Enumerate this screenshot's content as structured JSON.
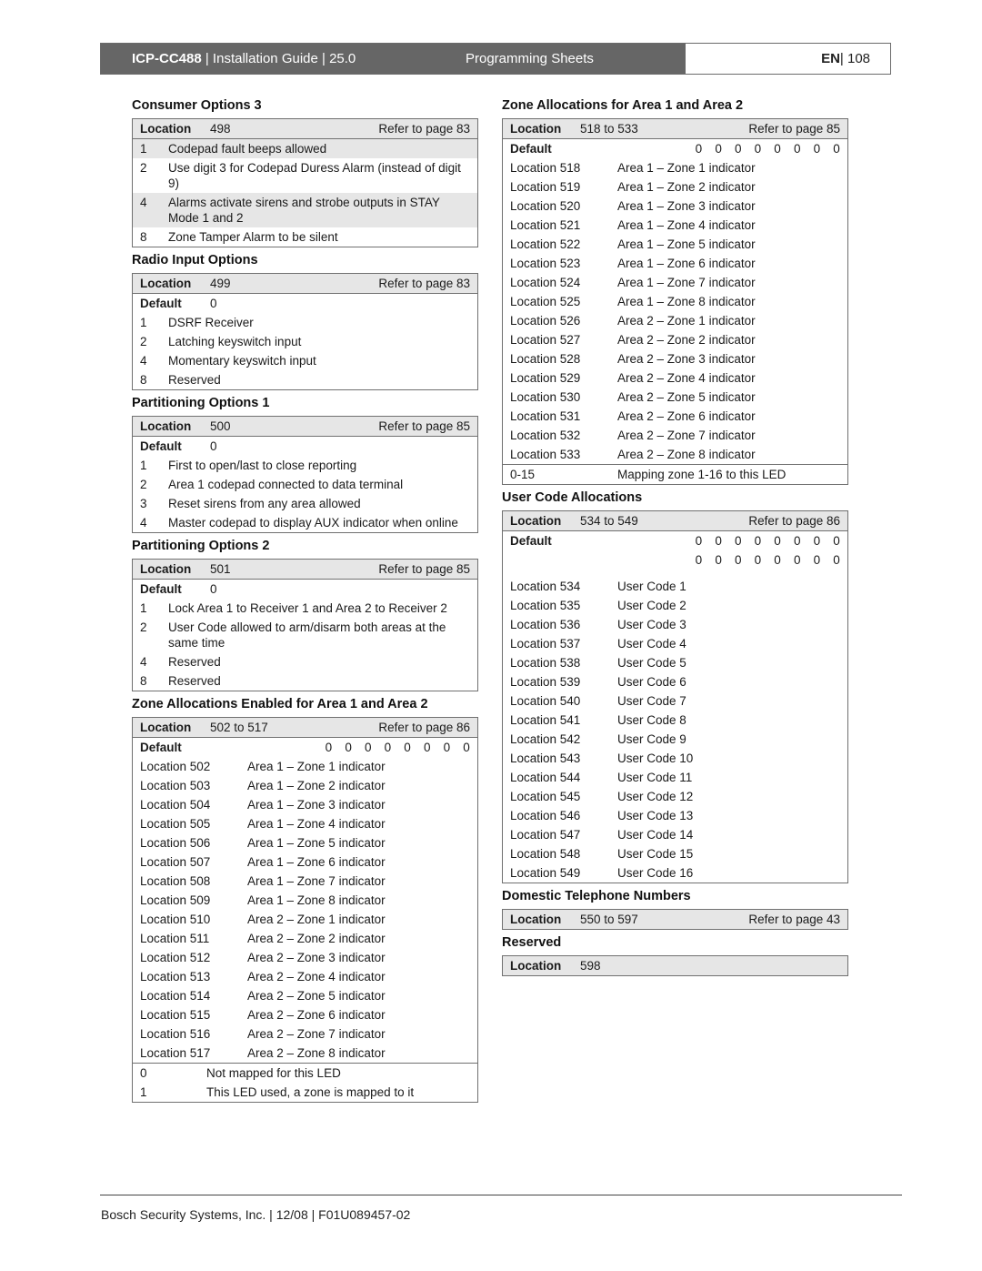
{
  "header": {
    "product": "ICP-CC488",
    "doc_title": " | Installation Guide | 25.0",
    "section": "Programming Sheets",
    "lang": "EN",
    "page": " | 108"
  },
  "left": {
    "consumer3": {
      "title": "Consumer Options 3",
      "loc_label": "Location",
      "loc_value": "498",
      "ref": "Refer to page 83",
      "items": [
        {
          "bit": "1",
          "text": "Codepad fault beeps allowed"
        },
        {
          "bit": "2",
          "text": "Use digit 3 for Codepad Duress Alarm (instead of digit 9)"
        },
        {
          "bit": "4",
          "text": "Alarms activate sirens and strobe outputs in STAY Mode 1 and 2"
        },
        {
          "bit": "8",
          "text": "Zone Tamper Alarm to be silent"
        }
      ]
    },
    "radio": {
      "title": "Radio Input Options",
      "loc_label": "Location",
      "loc_value": "499",
      "ref": "Refer to page 83",
      "def_label": "Default",
      "def_value": "0",
      "items": [
        {
          "bit": "1",
          "text": "DSRF Receiver"
        },
        {
          "bit": "2",
          "text": "Latching keyswitch input"
        },
        {
          "bit": "4",
          "text": "Momentary keyswitch input"
        },
        {
          "bit": "8",
          "text": "Reserved"
        }
      ]
    },
    "part1": {
      "title": "Partitioning Options 1",
      "loc_label": "Location",
      "loc_value": "500",
      "ref": "Refer to page 85",
      "def_label": "Default",
      "def_value": "0",
      "items": [
        {
          "bit": "1",
          "text": "First to open/last to close reporting"
        },
        {
          "bit": "2",
          "text": "Area 1 codepad connected to data terminal"
        },
        {
          "bit": "3",
          "text": "Reset sirens from any area allowed"
        },
        {
          "bit": "4",
          "text": "Master codepad to display AUX indicator when online"
        }
      ]
    },
    "part2": {
      "title": "Partitioning Options 2",
      "loc_label": "Location",
      "loc_value": "501",
      "ref": "Refer to page 85",
      "def_label": "Default",
      "def_value": "0",
      "items": [
        {
          "bit": "1",
          "text": "Lock Area 1 to Receiver 1 and Area 2 to Receiver 2"
        },
        {
          "bit": "2",
          "text": "User Code allowed to arm/disarm both areas at the same time"
        },
        {
          "bit": "4",
          "text": "Reserved"
        },
        {
          "bit": "8",
          "text": "Reserved"
        }
      ]
    },
    "zone_enabled": {
      "title": "Zone Allocations Enabled for Area 1 and Area 2",
      "loc_label": "Location",
      "loc_value": "502 to 517",
      "ref": "Refer to page 86",
      "def_label": "Default",
      "def_value": "0 0 0 0 0 0 0 0",
      "items": [
        {
          "loc": "Location 502",
          "text": "Area 1 – Zone 1 indicator"
        },
        {
          "loc": "Location 503",
          "text": "Area 1 – Zone 2 indicator"
        },
        {
          "loc": "Location 504",
          "text": "Area 1 – Zone 3 indicator"
        },
        {
          "loc": "Location 505",
          "text": "Area 1 – Zone 4 indicator"
        },
        {
          "loc": "Location 506",
          "text": "Area 1 – Zone 5 indicator"
        },
        {
          "loc": "Location 507",
          "text": "Area 1 – Zone 6 indicator"
        },
        {
          "loc": "Location 508",
          "text": "Area 1 – Zone 7 indicator"
        },
        {
          "loc": "Location 509",
          "text": "Area 1 – Zone 8 indicator"
        },
        {
          "loc": "Location 510",
          "text": "Area 2 – Zone 1 indicator"
        },
        {
          "loc": "Location 511",
          "text": "Area 2 – Zone 2 indicator"
        },
        {
          "loc": "Location 512",
          "text": "Area 2 – Zone 3 indicator"
        },
        {
          "loc": "Location 513",
          "text": "Area 2 – Zone 4 indicator"
        },
        {
          "loc": "Location 514",
          "text": "Area 2 – Zone 5 indicator"
        },
        {
          "loc": "Location 515",
          "text": "Area 2 – Zone 6 indicator"
        },
        {
          "loc": "Location 516",
          "text": "Area 2 – Zone 7 indicator"
        },
        {
          "loc": "Location 517",
          "text": "Area 2 – Zone 8 indicator"
        }
      ],
      "legend": [
        {
          "val": "0",
          "text": "Not mapped for this LED"
        },
        {
          "val": "1",
          "text": "This LED used, a zone is mapped to it"
        }
      ]
    }
  },
  "right": {
    "zone_alloc": {
      "title": "Zone Allocations for Area 1 and Area 2",
      "loc_label": "Location",
      "loc_value": "518 to 533",
      "ref": "Refer to page 85",
      "def_label": "Default",
      "def_value": "0 0 0 0 0 0 0 0",
      "items": [
        {
          "loc": "Location 518",
          "text": "Area 1 – Zone 1 indicator"
        },
        {
          "loc": "Location 519",
          "text": "Area 1 – Zone 2 indicator"
        },
        {
          "loc": "Location 520",
          "text": "Area 1 – Zone 3 indicator"
        },
        {
          "loc": "Location 521",
          "text": "Area 1 – Zone 4 indicator"
        },
        {
          "loc": "Location 522",
          "text": "Area 1 – Zone 5 indicator"
        },
        {
          "loc": "Location 523",
          "text": "Area 1 – Zone 6 indicator"
        },
        {
          "loc": "Location 524",
          "text": "Area 1 – Zone 7 indicator"
        },
        {
          "loc": "Location 525",
          "text": "Area 1 – Zone 8 indicator"
        },
        {
          "loc": "Location 526",
          "text": "Area 2 – Zone 1 indicator"
        },
        {
          "loc": "Location 527",
          "text": "Area 2 – Zone 2 indicator"
        },
        {
          "loc": "Location 528",
          "text": "Area 2 – Zone 3 indicator"
        },
        {
          "loc": "Location 529",
          "text": "Area 2 – Zone 4 indicator"
        },
        {
          "loc": "Location 530",
          "text": "Area 2 – Zone 5 indicator"
        },
        {
          "loc": "Location 531",
          "text": "Area 2 – Zone 6 indicator"
        },
        {
          "loc": "Location 532",
          "text": "Area 2 – Zone 7 indicator"
        },
        {
          "loc": "Location 533",
          "text": "Area 2 – Zone 8 indicator"
        }
      ],
      "legend": [
        {
          "val": "0-15",
          "text": "Mapping zone 1-16 to this LED"
        }
      ]
    },
    "user_codes": {
      "title": "User Code Allocations",
      "loc_label": "Location",
      "loc_value": "534 to 549",
      "ref": "Refer to page 86",
      "def_label": "Default",
      "def_value": "0 0 0 0 0 0 0 0",
      "def_value2": "0 0 0 0 0 0 0 0",
      "items": [
        {
          "loc": "Location 534",
          "text": "User Code 1"
        },
        {
          "loc": "Location 535",
          "text": "User Code 2"
        },
        {
          "loc": "Location 536",
          "text": "User Code 3"
        },
        {
          "loc": "Location 537",
          "text": "User Code 4"
        },
        {
          "loc": "Location 538",
          "text": "User Code 5"
        },
        {
          "loc": "Location 539",
          "text": "User Code 6"
        },
        {
          "loc": "Location 540",
          "text": "User Code 7"
        },
        {
          "loc": "Location 541",
          "text": "User Code 8"
        },
        {
          "loc": "Location 542",
          "text": "User Code 9"
        },
        {
          "loc": "Location 543",
          "text": "User Code 10"
        },
        {
          "loc": "Location 544",
          "text": "User Code 11"
        },
        {
          "loc": "Location 545",
          "text": "User Code 12"
        },
        {
          "loc": "Location 546",
          "text": "User Code 13"
        },
        {
          "loc": "Location 547",
          "text": "User Code 14"
        },
        {
          "loc": "Location 548",
          "text": "User Code 15"
        },
        {
          "loc": "Location 549",
          "text": "User Code 16"
        }
      ]
    },
    "phone": {
      "title": "Domestic Telephone Numbers",
      "loc_label": "Location",
      "loc_value": "550 to 597",
      "ref": "Refer to page 43"
    },
    "reserved": {
      "title": "Reserved",
      "loc_label": "Location",
      "loc_value": "598"
    }
  },
  "footer": {
    "text": "Bosch Security Systems, Inc. | 12/08 | F01U089457-02"
  },
  "colors": {
    "header_dark": "#666666",
    "row_shade": "#e6e6e6",
    "border": "#707070"
  }
}
